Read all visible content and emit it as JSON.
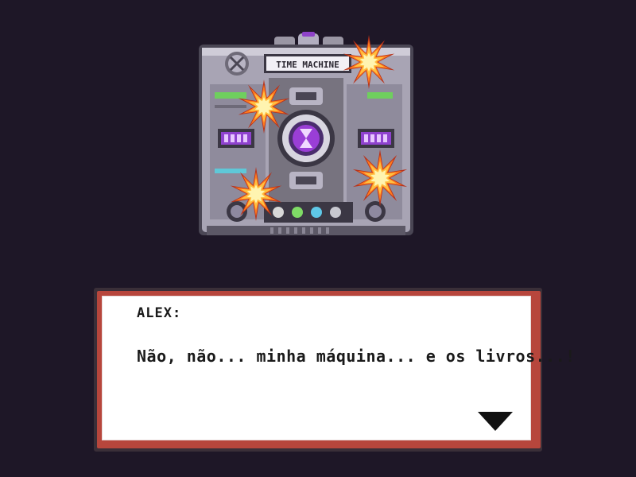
{
  "machine": {
    "sign_text": "TIME MACHINE"
  },
  "dialog": {
    "speaker": "ALEX:",
    "line": "Não, não... minha máquina... e os livros...!",
    "advance_icon": "triangle-down-icon"
  },
  "colors": {
    "background": "#1e1727",
    "dialog_border": "#b7463c",
    "dialog_fill": "#ffffff",
    "glow_purple": "#9a3ed6",
    "explosion_core": "#ffe27a",
    "explosion_outer": "#e04a1a"
  }
}
